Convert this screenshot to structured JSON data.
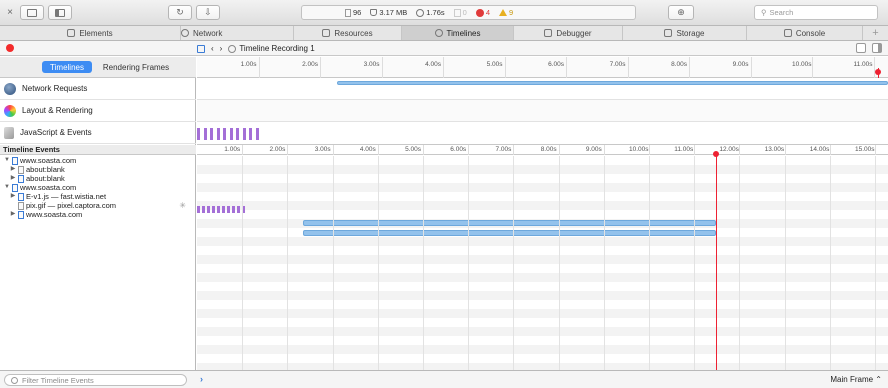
{
  "toolbar": {
    "close_glyph": "×",
    "reload_glyph": "↻",
    "download_glyph": "⇩",
    "target_glyph": "⊕",
    "add_glyph": "+",
    "activity": {
      "resources_count": "96",
      "size": "3.17 MB",
      "time": "1.76s",
      "logs": "0",
      "errors": "4",
      "warnings": "9"
    },
    "search_placeholder": "Search"
  },
  "tabs": [
    {
      "label": "Elements",
      "icon": "elements-icon"
    },
    {
      "label": "Network",
      "icon": "network-icon"
    },
    {
      "label": "Resources",
      "icon": "resources-icon"
    },
    {
      "label": "Timelines",
      "icon": "timelines-icon",
      "active": true
    },
    {
      "label": "Debugger",
      "icon": "debugger-icon"
    },
    {
      "label": "Storage",
      "icon": "storage-icon"
    },
    {
      "label": "Console",
      "icon": "console-icon"
    }
  ],
  "breadcrumb": {
    "recording": "Timeline Recording 1"
  },
  "modes": {
    "timelines": "Timelines",
    "rendering_frames": "Rendering Frames"
  },
  "overview_rows": [
    {
      "label": "Network Requests",
      "icon": "network-globe-icon"
    },
    {
      "label": "Layout & Rendering",
      "icon": "color-wheel-icon"
    },
    {
      "label": "JavaScript & Events",
      "icon": "script-icon"
    }
  ],
  "events_header": "Timeline Events",
  "overview_ticks": [
    "1.00s",
    "2.00s",
    "3.00s",
    "4.00s",
    "5.00s",
    "6.00s",
    "7.00s",
    "8.00s",
    "9.00s",
    "10.00s",
    "11.00s"
  ],
  "detail_ticks": [
    "1.00s",
    "2.00s",
    "3.00s",
    "4.00s",
    "5.00s",
    "6.00s",
    "7.00s",
    "8.00s",
    "9.00s",
    "10.00s",
    "11.00s",
    "12.00s",
    "13.00s",
    "14.00s",
    "15.00s"
  ],
  "tree": [
    {
      "label": "www.soasta.com",
      "expanded": true,
      "indent": 0
    },
    {
      "label": "about:blank",
      "expanded": false,
      "indent": 1
    },
    {
      "label": "about:blank",
      "expanded": false,
      "indent": 1
    },
    {
      "label": "www.soasta.com",
      "expanded": true,
      "indent": 0
    },
    {
      "label": "E-v1.js — fast.wistia.net",
      "expanded": false,
      "indent": 1
    },
    {
      "label": "pix.gif — pixel.captora.com",
      "expanded": null,
      "indent": 1
    },
    {
      "label": "www.soasta.com",
      "expanded": false,
      "indent": 1
    }
  ],
  "bottom": {
    "filter_placeholder": "Filter Timeline Events",
    "prompt": "›",
    "frame_selector": "Main Frame ⌃"
  }
}
